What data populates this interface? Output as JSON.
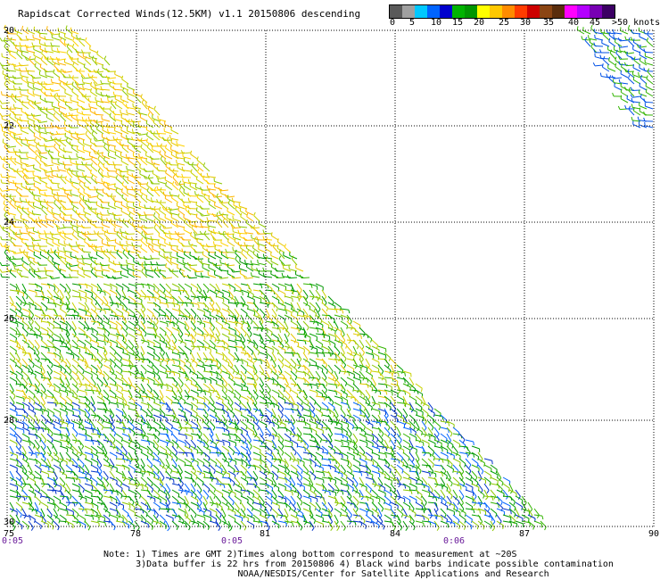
{
  "title": "Rapidscat Corrected Winds(12.5KM) v1.1 20150806 descending",
  "scale": {
    "colors": [
      "#5a5a5a",
      "#a0a0a0",
      "#00c8ff",
      "#0064ff",
      "#0000cd",
      "#00b400",
      "#009600",
      "#ffff00",
      "#ffc800",
      "#ff8c00",
      "#ff3c00",
      "#cd0000",
      "#8b4513",
      "#5a2d0c",
      "#ff00ff",
      "#b400ff",
      "#7800b4",
      "#3c0064"
    ],
    "labels": [
      "0",
      "5",
      "10",
      "15",
      "20",
      "25",
      "30",
      "35",
      "40",
      "45",
      ">50 knots"
    ]
  },
  "lat_labels": [
    "20",
    "22",
    "24",
    "26",
    "28",
    "30"
  ],
  "lon_labels": [
    "75",
    "78",
    "81",
    "84",
    "87",
    "90"
  ],
  "time_labels": [
    "0:05",
    "0:05",
    "0:06"
  ],
  "notes": [
    "Note: 1) Times are GMT 2)Times along bottom correspond to measurement at ~20S",
    "      3)Data buffer is 22 hrs from 20150806 4) Black wind barbs indicate possible contamination",
    "                         NOAA/NESDIS/Center for Satellite Applications and Research"
  ]
}
